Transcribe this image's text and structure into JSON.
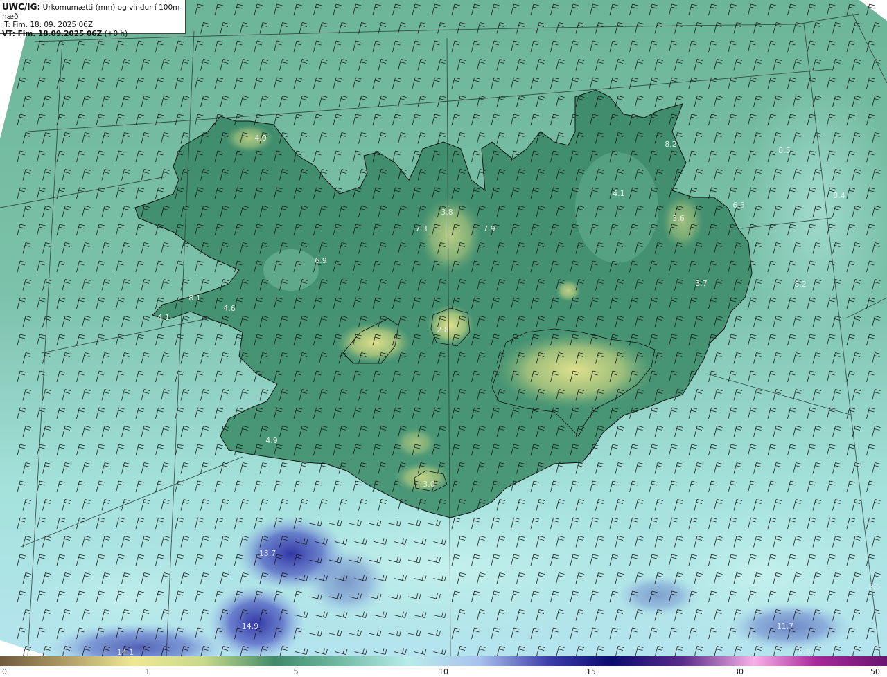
{
  "info": {
    "model": "UWC/IG:",
    "title": "Úrkomumætti (mm) og vindur í 100m hæð",
    "it_label": "IT: Fim. 18. 09. 2025 06Z",
    "vt_label": "VT: Fim. 18.09.2025 06Z",
    "vt_offset": "(+0 h)"
  },
  "colorbar": {
    "ticks": [
      {
        "label": "0",
        "value": 0
      },
      {
        "label": "1",
        "value": 1
      },
      {
        "label": "5",
        "value": 5
      },
      {
        "label": "10",
        "value": 10
      },
      {
        "label": "15",
        "value": 15
      },
      {
        "label": "30",
        "value": 30
      },
      {
        "label": "50",
        "value": 50
      }
    ],
    "colors": [
      "#6f5a3c",
      "#b3a26a",
      "#efe893",
      "#c8d98a",
      "#3f8a6a",
      "#6fb8a0",
      "#b8ecea",
      "#a9c2ee",
      "#3b3ca8",
      "#0b0b6e",
      "#5a2c8a",
      "#f8b0e8",
      "#a8299a",
      "#6a1470"
    ]
  },
  "values": [
    {
      "text": "4.0",
      "color": "#e8ece0"
    },
    {
      "text": "3.8",
      "color": "#e8ece0"
    },
    {
      "text": "7.3",
      "color": "#e8ece0"
    },
    {
      "text": "7.9",
      "color": "#e8ece0"
    },
    {
      "text": "4.1",
      "color": "#e8ece0"
    },
    {
      "text": "3.6",
      "color": "#e8ece0"
    },
    {
      "text": "8.2",
      "color": "#dfeff0"
    },
    {
      "text": "8.5",
      "color": "#dfeff0"
    },
    {
      "text": "8.4",
      "color": "#dfeff0"
    },
    {
      "text": "6.5",
      "color": "#dfeff0"
    },
    {
      "text": "3.7",
      "color": "#e8ece0"
    },
    {
      "text": "8.2",
      "color": "#dfeff0"
    },
    {
      "text": "8.1",
      "color": "#e8ece0"
    },
    {
      "text": "4.6",
      "color": "#e8ece0"
    },
    {
      "text": "4.1",
      "color": "#e8ece0"
    },
    {
      "text": "6.9",
      "color": "#e8ece0"
    },
    {
      "text": "2.8",
      "color": "#e8ece0"
    },
    {
      "text": "4.9",
      "color": "#e8ece0"
    },
    {
      "text": "3.0",
      "color": "#e8ece0"
    },
    {
      "text": "13.7",
      "color": "#e6e8ff"
    },
    {
      "text": "14.9",
      "color": "#e6e8ff"
    },
    {
      "text": "14.1",
      "color": "#e6e8ff"
    },
    {
      "text": "11.7",
      "color": "#e6e8ff"
    },
    {
      "text": "9.8",
      "color": "#dfeff0"
    },
    {
      "text": "9.5",
      "color": "#dfeff0"
    }
  ],
  "wind_barbs": {
    "barb": "100m wind barbs"
  }
}
